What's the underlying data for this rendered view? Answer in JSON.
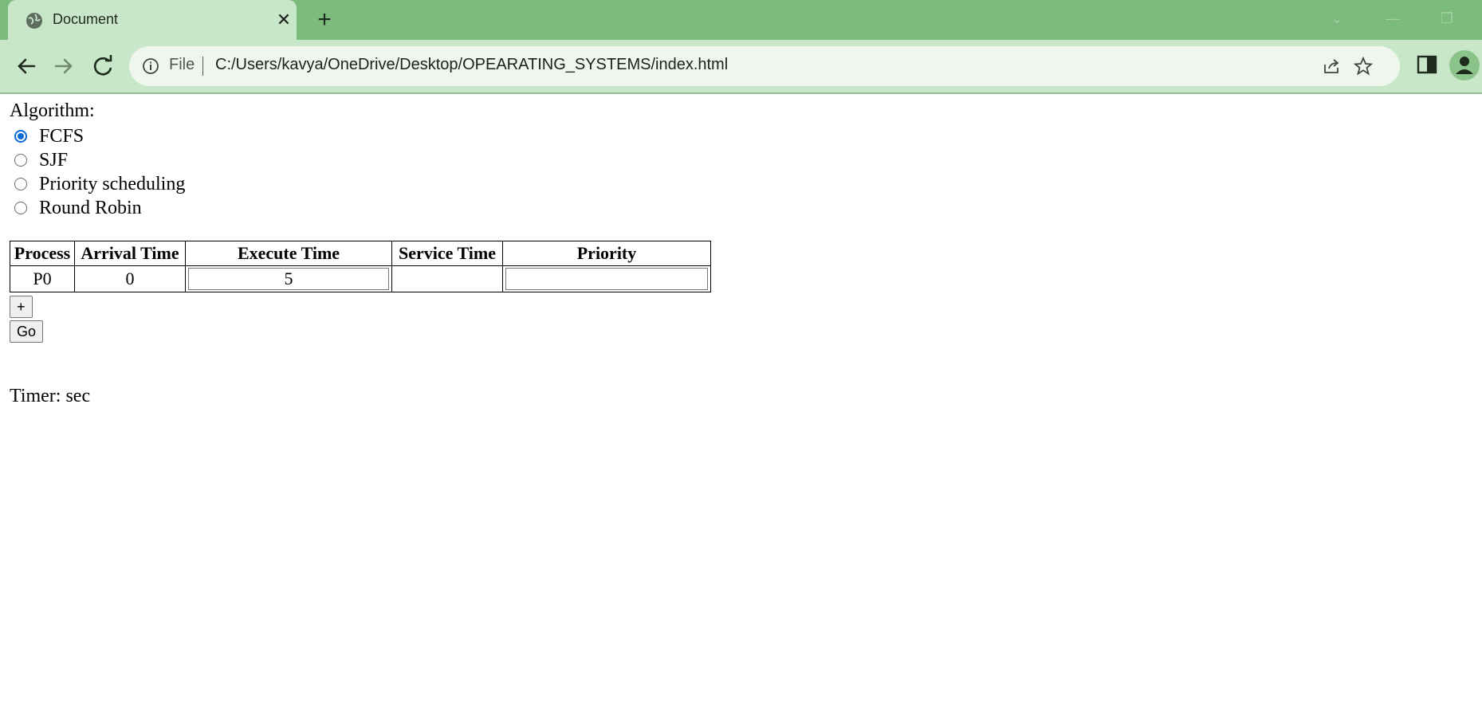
{
  "browser": {
    "tab_title": "Document",
    "new_tab_symbol": "+",
    "close_symbol": "✕",
    "address_scheme_label": "File",
    "url": "C:/Users/kavya/OneDrive/Desktop/OPEARATING_SYSTEMS/index.html",
    "accent_color": "#7bbb7b",
    "toolbar_color": "#c8e6c8"
  },
  "page": {
    "algorithm_label": "Algorithm:",
    "algorithms": [
      {
        "label": "FCFS",
        "selected": true
      },
      {
        "label": "SJF",
        "selected": false
      },
      {
        "label": "Priority scheduling",
        "selected": false
      },
      {
        "label": "Round Robin",
        "selected": false
      }
    ],
    "table": {
      "headers": [
        "Process",
        "Arrival Time",
        "Execute Time",
        "Service Time",
        "Priority"
      ],
      "rows": [
        {
          "process": "P0",
          "arrival": "0",
          "execute": "5",
          "service": "",
          "priority": ""
        }
      ]
    },
    "add_button": "+",
    "go_button": "Go",
    "timer_text": "Timer: sec"
  }
}
